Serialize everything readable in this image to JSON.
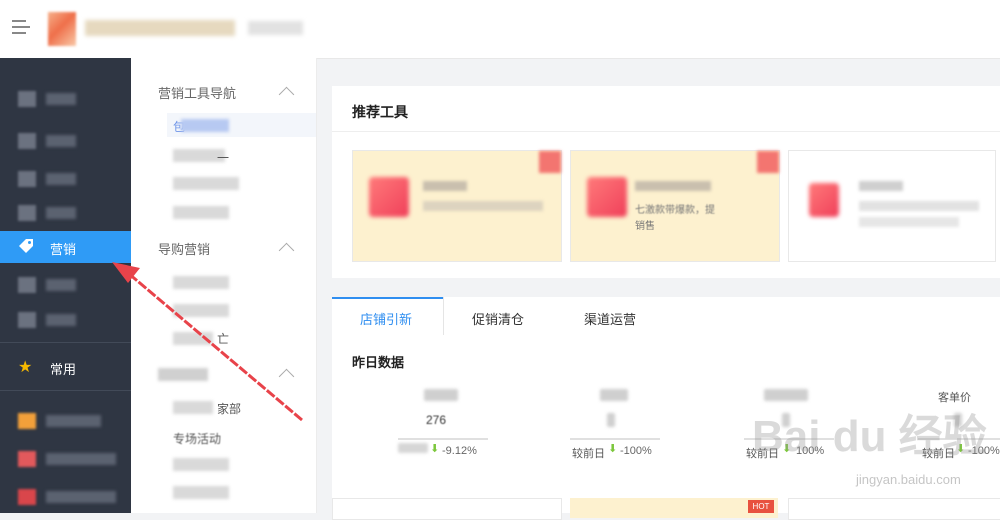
{
  "sidebar": {
    "active_label": "营销",
    "common_label": "常用"
  },
  "subnav": {
    "group1_title": "营销工具导航",
    "group2_title": "导购营销",
    "item_partial_1": "包",
    "item_partial_2": "一",
    "item_partial_3": "亡",
    "item_partial_4": "家部",
    "item_partial_5": "专场活动"
  },
  "main": {
    "recommend_title": "推荐工具",
    "card2_line1": "七激款带爆款，提",
    "card2_line2": "销售",
    "tabs": [
      "店铺引新",
      "促销清仓",
      "渠道运营"
    ],
    "yesterday_title": "昨日数据",
    "stats": [
      {
        "value_partial": "276",
        "compare_label": "较前日",
        "pct": "-9.12%"
      },
      {
        "value_partial": "",
        "compare_label": "较前日",
        "pct": "-100%"
      },
      {
        "value_partial": "",
        "compare_label": "较前日",
        "pct": "100%"
      },
      {
        "value_partial": "",
        "head_label": "客单价",
        "compare_label": "较前日",
        "pct": "-100%"
      }
    ],
    "hot_badge": "HOT"
  },
  "watermark": {
    "brand": "Bai du 经验",
    "url": "jingyan.baidu.com"
  },
  "colors": {
    "sidebar_bg": "#2f3643",
    "accent": "#2f9bf6",
    "card_yellow": "#fdf1cf",
    "arrow_red": "#e8434a",
    "down_green": "#7cc73c"
  }
}
